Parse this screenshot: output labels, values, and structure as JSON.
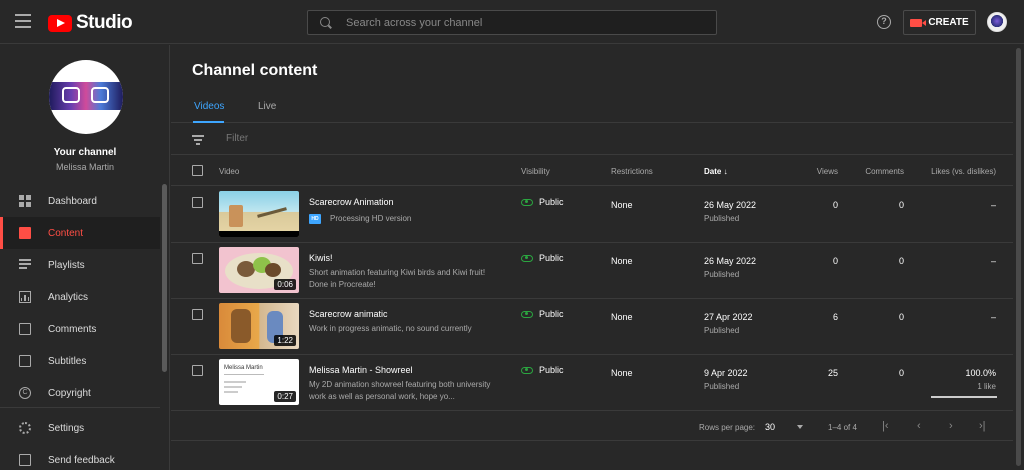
{
  "header": {
    "logo_text": "Studio",
    "search_placeholder": "Search across your channel",
    "help_glyph": "?",
    "create_label": "CREATE"
  },
  "sidebar": {
    "your_channel": "Your channel",
    "channel_name": "Melissa Martin",
    "items": [
      {
        "label": "Dashboard",
        "icon": "dashboard-icon"
      },
      {
        "label": "Content",
        "icon": "content-icon",
        "active": true
      },
      {
        "label": "Playlists",
        "icon": "playlists-icon"
      },
      {
        "label": "Analytics",
        "icon": "analytics-icon"
      },
      {
        "label": "Comments",
        "icon": "comments-icon"
      },
      {
        "label": "Subtitles",
        "icon": "subtitles-icon"
      },
      {
        "label": "Copyright",
        "icon": "copyright-icon"
      }
    ],
    "bottom_items": [
      {
        "label": "Settings",
        "icon": "settings-icon"
      },
      {
        "label": "Send feedback",
        "icon": "feedback-icon"
      }
    ],
    "copyright_glyph": "C"
  },
  "main": {
    "title": "Channel content",
    "tabs": [
      {
        "label": "Videos",
        "active": true
      },
      {
        "label": "Live"
      }
    ],
    "filter_placeholder": "Filter",
    "columns": {
      "video": "Video",
      "visibility": "Visibility",
      "restrictions": "Restrictions",
      "date": "Date ↓",
      "views": "Views",
      "comments": "Comments",
      "likes": "Likes (vs. dislikes)"
    },
    "rows": [
      {
        "title": "Scarecrow Animation",
        "badge": "HD",
        "description": "Processing HD version",
        "visibility": "Public",
        "restrictions": "None",
        "date": "26 May 2022",
        "status": "Published",
        "views": "0",
        "comments": "0",
        "likes": "–"
      },
      {
        "title": "Kiwis!",
        "description": "Short animation featuring Kiwi birds and Kiwi fruit! Done in Procreate!",
        "duration": "0:06",
        "visibility": "Public",
        "restrictions": "None",
        "date": "26 May 2022",
        "status": "Published",
        "views": "0",
        "comments": "0",
        "likes": "–"
      },
      {
        "title": "Scarecrow animatic",
        "description": "Work in progress animatic, no sound currently",
        "duration": "1:22",
        "visibility": "Public",
        "restrictions": "None",
        "date": "27 Apr 2022",
        "status": "Published",
        "views": "6",
        "comments": "0",
        "likes": "–"
      },
      {
        "title": "Melissa Martin - Showreel",
        "description": "My 2D animation showreel featuring both university work as well as personal work, hope yo...",
        "duration": "0:27",
        "thumb_title": "Melissa Martin",
        "visibility": "Public",
        "restrictions": "None",
        "date": "9 Apr 2022",
        "status": "Published",
        "views": "25",
        "comments": "0",
        "likes": "100.0%",
        "likes_sub": "1 like",
        "likes_ratio": 1.0
      }
    ],
    "pagination": {
      "rows_per_page_label": "Rows per page:",
      "rows_per_page": "30",
      "range": "1–4 of 4"
    }
  },
  "colors": {
    "accent_red": "#ff4e45",
    "accent_blue": "#3ea6ff",
    "public_green": "#2ba640"
  }
}
